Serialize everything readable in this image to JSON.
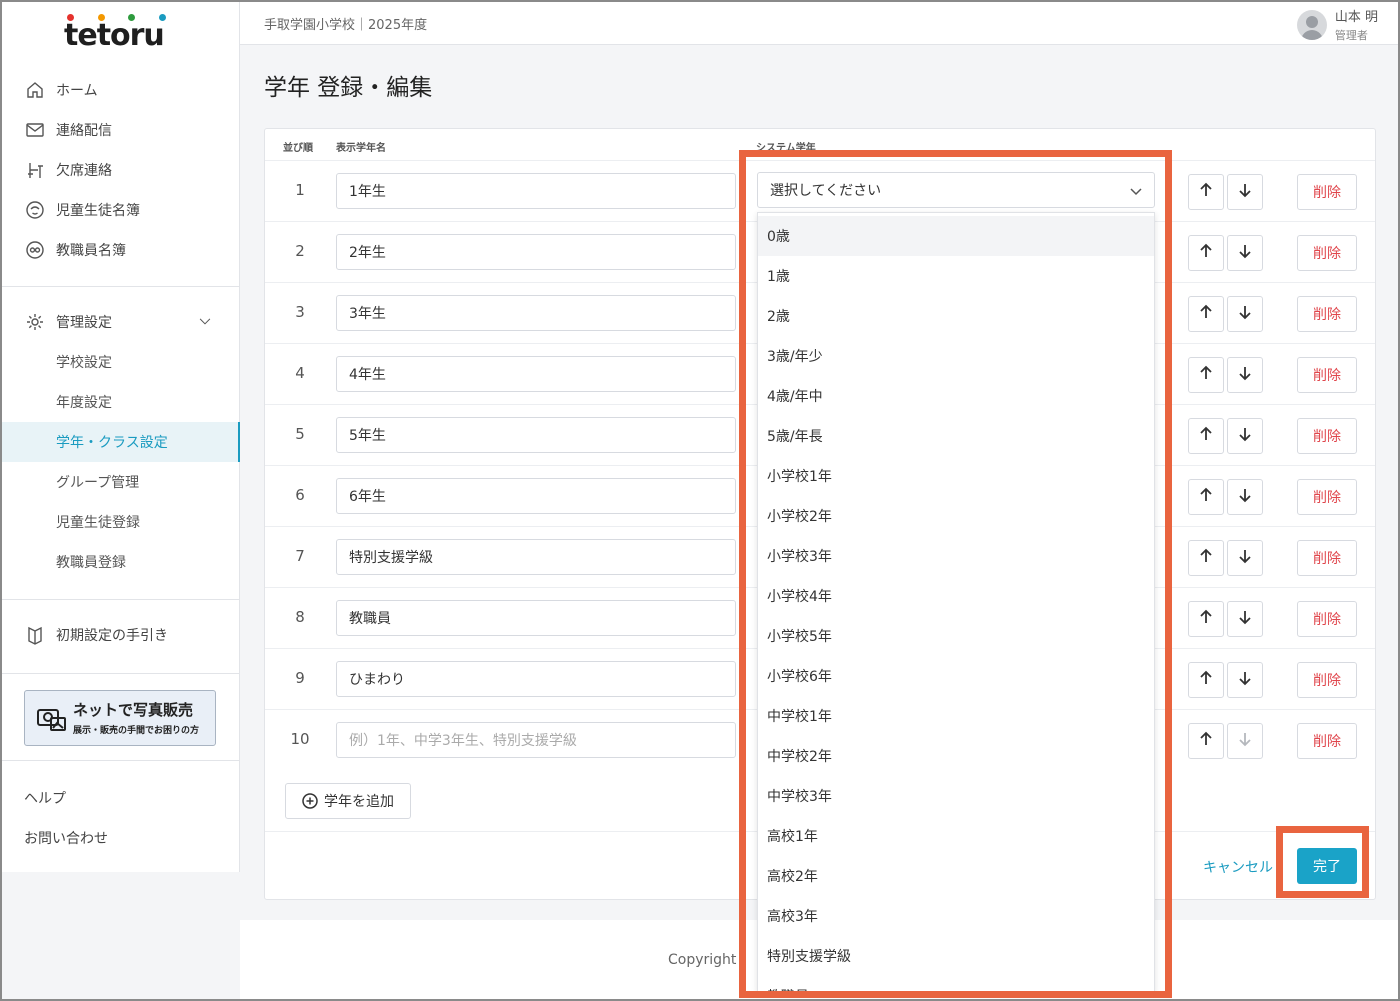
{
  "brand": {
    "logo_text": "tetoru",
    "dot_colors": [
      "#e5322d",
      "#f39800",
      "#2e9b3e",
      "#1a9bc0"
    ]
  },
  "header": {
    "school": "手取学園小学校｜2025年度",
    "user_name": "山本 明",
    "user_role": "管理者"
  },
  "sidebar": {
    "main": [
      {
        "label": "ホーム",
        "icon": "home-icon"
      },
      {
        "label": "連絡配信",
        "icon": "mail-icon"
      },
      {
        "label": "欠席連絡",
        "icon": "desk-icon"
      },
      {
        "label": "児童生徒名簿",
        "icon": "student-face-icon"
      },
      {
        "label": "教職員名簿",
        "icon": "teacher-face-icon"
      }
    ],
    "settings": {
      "label": "管理設定",
      "icon": "gear-icon"
    },
    "sub": [
      {
        "label": "学校設定"
      },
      {
        "label": "年度設定"
      },
      {
        "label": "学年・クラス設定"
      },
      {
        "label": "グループ管理"
      },
      {
        "label": "児童生徒登録"
      },
      {
        "label": "教職員登録"
      }
    ],
    "guide": {
      "label": "初期設定の手引き",
      "icon": "book-icon"
    },
    "banner": {
      "line1": "ネットで写真販売",
      "line2": "展示・販売の手間でお困りの方"
    },
    "help": "ヘルプ",
    "contact": "お問い合わせ"
  },
  "page": {
    "title": "学年 登録・編集"
  },
  "table": {
    "headers": {
      "order": "並び順",
      "name": "表示学年名",
      "system": "システム学年"
    },
    "rows": [
      {
        "num": "1",
        "name": "1年生"
      },
      {
        "num": "2",
        "name": "2年生"
      },
      {
        "num": "3",
        "name": "3年生"
      },
      {
        "num": "4",
        "name": "4年生"
      },
      {
        "num": "5",
        "name": "5年生"
      },
      {
        "num": "6",
        "name": "6年生"
      },
      {
        "num": "7",
        "name": "特別支援学級"
      },
      {
        "num": "8",
        "name": "教職員"
      },
      {
        "num": "9",
        "name": "ひまわり"
      },
      {
        "num": "10",
        "name": "",
        "placeholder": "例）1年、中学3年生、特別支援学級"
      }
    ],
    "delete_label": "削除",
    "add_label": "学年を追加"
  },
  "select": {
    "placeholder": "選択してください",
    "options": [
      "0歳",
      "1歳",
      "2歳",
      "3歳/年少",
      "4歳/年中",
      "5歳/年長",
      "小学校1年",
      "小学校2年",
      "小学校3年",
      "小学校4年",
      "小学校5年",
      "小学校6年",
      "中学校1年",
      "中学校2年",
      "中学校3年",
      "高校1年",
      "高校2年",
      "高校3年",
      "特別支援学級",
      "教職員"
    ]
  },
  "actions": {
    "cancel": "キャンセル",
    "done": "完了"
  },
  "footer": {
    "copyright": "Copyright"
  },
  "colors": {
    "accent": "#1aa3c8",
    "danger": "#e0464c",
    "highlight": "#e9643f"
  }
}
